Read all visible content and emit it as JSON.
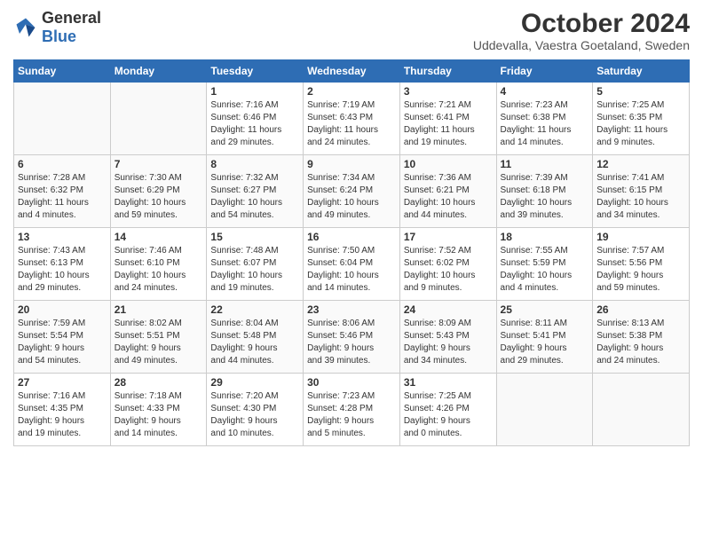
{
  "header": {
    "logo": {
      "general": "General",
      "blue": "Blue"
    },
    "title": "October 2024",
    "subtitle": "Uddevalla, Vaestra Goetaland, Sweden"
  },
  "calendar": {
    "days_of_week": [
      "Sunday",
      "Monday",
      "Tuesday",
      "Wednesday",
      "Thursday",
      "Friday",
      "Saturday"
    ],
    "weeks": [
      [
        {
          "day": "",
          "lines": []
        },
        {
          "day": "",
          "lines": []
        },
        {
          "day": "1",
          "lines": [
            "Sunrise: 7:16 AM",
            "Sunset: 6:46 PM",
            "Daylight: 11 hours",
            "and 29 minutes."
          ]
        },
        {
          "day": "2",
          "lines": [
            "Sunrise: 7:19 AM",
            "Sunset: 6:43 PM",
            "Daylight: 11 hours",
            "and 24 minutes."
          ]
        },
        {
          "day": "3",
          "lines": [
            "Sunrise: 7:21 AM",
            "Sunset: 6:41 PM",
            "Daylight: 11 hours",
            "and 19 minutes."
          ]
        },
        {
          "day": "4",
          "lines": [
            "Sunrise: 7:23 AM",
            "Sunset: 6:38 PM",
            "Daylight: 11 hours",
            "and 14 minutes."
          ]
        },
        {
          "day": "5",
          "lines": [
            "Sunrise: 7:25 AM",
            "Sunset: 6:35 PM",
            "Daylight: 11 hours",
            "and 9 minutes."
          ]
        }
      ],
      [
        {
          "day": "6",
          "lines": [
            "Sunrise: 7:28 AM",
            "Sunset: 6:32 PM",
            "Daylight: 11 hours",
            "and 4 minutes."
          ]
        },
        {
          "day": "7",
          "lines": [
            "Sunrise: 7:30 AM",
            "Sunset: 6:29 PM",
            "Daylight: 10 hours",
            "and 59 minutes."
          ]
        },
        {
          "day": "8",
          "lines": [
            "Sunrise: 7:32 AM",
            "Sunset: 6:27 PM",
            "Daylight: 10 hours",
            "and 54 minutes."
          ]
        },
        {
          "day": "9",
          "lines": [
            "Sunrise: 7:34 AM",
            "Sunset: 6:24 PM",
            "Daylight: 10 hours",
            "and 49 minutes."
          ]
        },
        {
          "day": "10",
          "lines": [
            "Sunrise: 7:36 AM",
            "Sunset: 6:21 PM",
            "Daylight: 10 hours",
            "and 44 minutes."
          ]
        },
        {
          "day": "11",
          "lines": [
            "Sunrise: 7:39 AM",
            "Sunset: 6:18 PM",
            "Daylight: 10 hours",
            "and 39 minutes."
          ]
        },
        {
          "day": "12",
          "lines": [
            "Sunrise: 7:41 AM",
            "Sunset: 6:15 PM",
            "Daylight: 10 hours",
            "and 34 minutes."
          ]
        }
      ],
      [
        {
          "day": "13",
          "lines": [
            "Sunrise: 7:43 AM",
            "Sunset: 6:13 PM",
            "Daylight: 10 hours",
            "and 29 minutes."
          ]
        },
        {
          "day": "14",
          "lines": [
            "Sunrise: 7:46 AM",
            "Sunset: 6:10 PM",
            "Daylight: 10 hours",
            "and 24 minutes."
          ]
        },
        {
          "day": "15",
          "lines": [
            "Sunrise: 7:48 AM",
            "Sunset: 6:07 PM",
            "Daylight: 10 hours",
            "and 19 minutes."
          ]
        },
        {
          "day": "16",
          "lines": [
            "Sunrise: 7:50 AM",
            "Sunset: 6:04 PM",
            "Daylight: 10 hours",
            "and 14 minutes."
          ]
        },
        {
          "day": "17",
          "lines": [
            "Sunrise: 7:52 AM",
            "Sunset: 6:02 PM",
            "Daylight: 10 hours",
            "and 9 minutes."
          ]
        },
        {
          "day": "18",
          "lines": [
            "Sunrise: 7:55 AM",
            "Sunset: 5:59 PM",
            "Daylight: 10 hours",
            "and 4 minutes."
          ]
        },
        {
          "day": "19",
          "lines": [
            "Sunrise: 7:57 AM",
            "Sunset: 5:56 PM",
            "Daylight: 9 hours",
            "and 59 minutes."
          ]
        }
      ],
      [
        {
          "day": "20",
          "lines": [
            "Sunrise: 7:59 AM",
            "Sunset: 5:54 PM",
            "Daylight: 9 hours",
            "and 54 minutes."
          ]
        },
        {
          "day": "21",
          "lines": [
            "Sunrise: 8:02 AM",
            "Sunset: 5:51 PM",
            "Daylight: 9 hours",
            "and 49 minutes."
          ]
        },
        {
          "day": "22",
          "lines": [
            "Sunrise: 8:04 AM",
            "Sunset: 5:48 PM",
            "Daylight: 9 hours",
            "and 44 minutes."
          ]
        },
        {
          "day": "23",
          "lines": [
            "Sunrise: 8:06 AM",
            "Sunset: 5:46 PM",
            "Daylight: 9 hours",
            "and 39 minutes."
          ]
        },
        {
          "day": "24",
          "lines": [
            "Sunrise: 8:09 AM",
            "Sunset: 5:43 PM",
            "Daylight: 9 hours",
            "and 34 minutes."
          ]
        },
        {
          "day": "25",
          "lines": [
            "Sunrise: 8:11 AM",
            "Sunset: 5:41 PM",
            "Daylight: 9 hours",
            "and 29 minutes."
          ]
        },
        {
          "day": "26",
          "lines": [
            "Sunrise: 8:13 AM",
            "Sunset: 5:38 PM",
            "Daylight: 9 hours",
            "and 24 minutes."
          ]
        }
      ],
      [
        {
          "day": "27",
          "lines": [
            "Sunrise: 7:16 AM",
            "Sunset: 4:35 PM",
            "Daylight: 9 hours",
            "and 19 minutes."
          ]
        },
        {
          "day": "28",
          "lines": [
            "Sunrise: 7:18 AM",
            "Sunset: 4:33 PM",
            "Daylight: 9 hours",
            "and 14 minutes."
          ]
        },
        {
          "day": "29",
          "lines": [
            "Sunrise: 7:20 AM",
            "Sunset: 4:30 PM",
            "Daylight: 9 hours",
            "and 10 minutes."
          ]
        },
        {
          "day": "30",
          "lines": [
            "Sunrise: 7:23 AM",
            "Sunset: 4:28 PM",
            "Daylight: 9 hours",
            "and 5 minutes."
          ]
        },
        {
          "day": "31",
          "lines": [
            "Sunrise: 7:25 AM",
            "Sunset: 4:26 PM",
            "Daylight: 9 hours",
            "and 0 minutes."
          ]
        },
        {
          "day": "",
          "lines": []
        },
        {
          "day": "",
          "lines": []
        }
      ]
    ]
  }
}
